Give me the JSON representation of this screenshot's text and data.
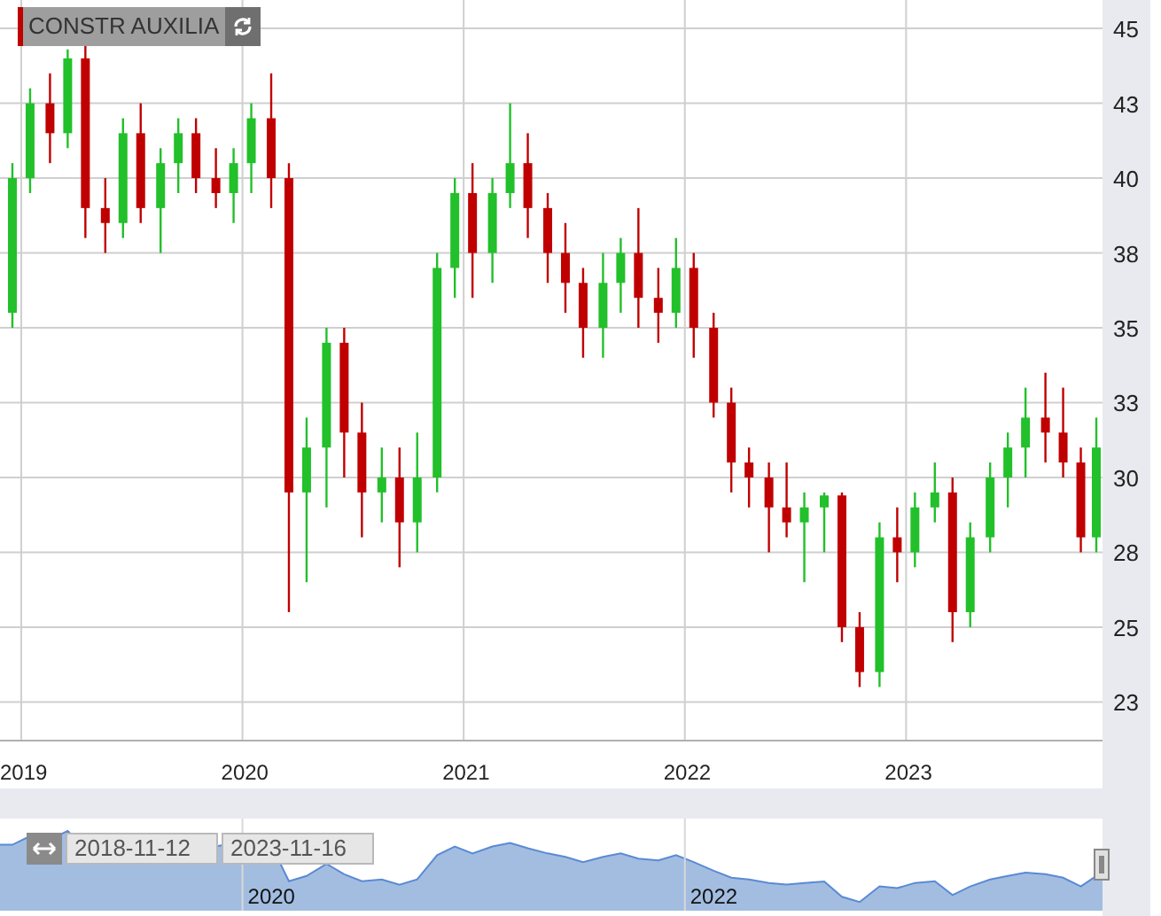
{
  "instrument": {
    "name": "CONSTR AUXILIA"
  },
  "chart": {
    "chart_data": {
      "type": "candlestick",
      "x": [
        2018.96,
        2019.04,
        2019.13,
        2019.21,
        2019.29,
        2019.38,
        2019.46,
        2019.54,
        2019.63,
        2019.71,
        2019.79,
        2019.88,
        2019.96,
        2020.04,
        2020.13,
        2020.21,
        2020.29,
        2020.38,
        2020.46,
        2020.54,
        2020.63,
        2020.71,
        2020.79,
        2020.88,
        2020.96,
        2021.04,
        2021.13,
        2021.21,
        2021.29,
        2021.38,
        2021.46,
        2021.54,
        2021.63,
        2021.71,
        2021.79,
        2021.88,
        2021.96,
        2022.04,
        2022.13,
        2022.21,
        2022.29,
        2022.38,
        2022.46,
        2022.54,
        2022.63,
        2022.71,
        2022.79,
        2022.88,
        2022.96,
        2023.04,
        2023.13,
        2023.21,
        2023.29,
        2023.38,
        2023.46,
        2023.54,
        2023.63,
        2023.71,
        2023.79,
        2023.86
      ],
      "ohlc": [
        [
          35.5,
          40.5,
          35,
          40
        ],
        [
          40,
          43,
          39.5,
          42.5
        ],
        [
          42.5,
          43.5,
          40.5,
          41.5
        ],
        [
          41.5,
          44.3,
          41,
          44
        ],
        [
          44,
          44.5,
          38,
          39
        ],
        [
          39,
          40,
          37.5,
          38.5
        ],
        [
          38.5,
          42,
          38,
          41.5
        ],
        [
          41.5,
          42.5,
          38.5,
          39
        ],
        [
          39,
          41,
          37.5,
          40.5
        ],
        [
          40.5,
          42,
          39.5,
          41.5
        ],
        [
          41.5,
          42,
          39.5,
          40
        ],
        [
          40,
          41,
          39,
          39.5
        ],
        [
          39.5,
          41,
          38.5,
          40.5
        ],
        [
          40.5,
          42.5,
          39.5,
          42
        ],
        [
          42,
          43.5,
          39,
          40
        ],
        [
          40,
          40.5,
          25.5,
          29.5
        ],
        [
          29.5,
          32,
          26.5,
          31
        ],
        [
          31,
          35,
          29,
          34.5
        ],
        [
          34.5,
          35,
          30,
          31.5
        ],
        [
          31.5,
          32.5,
          28,
          29.5
        ],
        [
          29.5,
          31,
          28.5,
          30
        ],
        [
          30,
          31,
          27,
          28.5
        ],
        [
          28.5,
          31.5,
          27.5,
          30
        ],
        [
          30,
          37.5,
          29.5,
          37
        ],
        [
          37,
          40,
          36,
          39.5
        ],
        [
          39.5,
          40.5,
          36,
          37.5
        ],
        [
          37.5,
          40,
          36.5,
          39.5
        ],
        [
          39.5,
          42.5,
          39,
          40.5
        ],
        [
          40.5,
          41.5,
          38,
          39
        ],
        [
          39,
          39.5,
          36.5,
          37.5
        ],
        [
          37.5,
          38.5,
          35.5,
          36.5
        ],
        [
          36.5,
          37,
          34,
          35
        ],
        [
          35,
          37.5,
          34,
          36.5
        ],
        [
          36.5,
          38,
          35.5,
          37.5
        ],
        [
          37.5,
          39,
          35,
          36
        ],
        [
          36,
          37,
          34.5,
          35.5
        ],
        [
          35.5,
          38,
          35,
          37
        ],
        [
          37,
          37.5,
          34,
          35
        ],
        [
          35,
          35.5,
          32,
          32.5
        ],
        [
          32.5,
          33,
          29.5,
          30.5
        ],
        [
          30.5,
          31,
          29,
          30
        ],
        [
          30,
          30.5,
          27.5,
          29
        ],
        [
          29,
          30.5,
          28,
          28.5
        ],
        [
          28.5,
          29.5,
          26.5,
          29
        ],
        [
          29,
          29.5,
          27.5,
          29.4
        ],
        [
          29.4,
          29.5,
          24.5,
          25
        ],
        [
          25,
          25.5,
          23,
          23.5
        ],
        [
          23.5,
          28.5,
          23,
          28
        ],
        [
          28,
          29,
          26.5,
          27.5
        ],
        [
          27.5,
          29.5,
          27,
          29
        ],
        [
          29,
          30.5,
          28.5,
          29.5
        ],
        [
          29.5,
          30,
          24.5,
          25.5
        ],
        [
          25.5,
          28.5,
          25,
          28
        ],
        [
          28,
          30.5,
          27.5,
          30
        ],
        [
          30,
          31.5,
          29,
          31
        ],
        [
          31,
          33,
          30,
          32
        ],
        [
          32,
          33.5,
          30.5,
          31.5
        ],
        [
          31.5,
          33,
          30,
          30.5
        ],
        [
          30.5,
          31,
          27.5,
          28
        ],
        [
          28,
          32,
          27.5,
          31
        ]
      ],
      "grid": true,
      "xlim": [
        2018.904,
        2023.888
      ],
      "ylim": [
        21.21,
        45.95
      ],
      "xticks": [
        {
          "value": 2019,
          "label": "2019"
        },
        {
          "value": 2020,
          "label": "2020"
        },
        {
          "value": 2021,
          "label": "2021"
        },
        {
          "value": 2022,
          "label": "2022"
        },
        {
          "value": 2023,
          "label": "2023"
        }
      ],
      "yticks": [
        {
          "value": 45,
          "label": "45"
        },
        {
          "value": 42.5,
          "label": "43"
        },
        {
          "value": 40,
          "label": "40"
        },
        {
          "value": 37.5,
          "label": "38"
        },
        {
          "value": 35,
          "label": "35"
        },
        {
          "value": 32.5,
          "label": "33"
        },
        {
          "value": 30,
          "label": "30"
        },
        {
          "value": 27.5,
          "label": "28"
        },
        {
          "value": 25,
          "label": "25"
        },
        {
          "value": 22.5,
          "label": "23"
        }
      ]
    }
  },
  "navigator": {
    "from": "2018-11-12",
    "to": "2023-11-16",
    "year_labels": [
      "2020",
      "2022"
    ]
  }
}
